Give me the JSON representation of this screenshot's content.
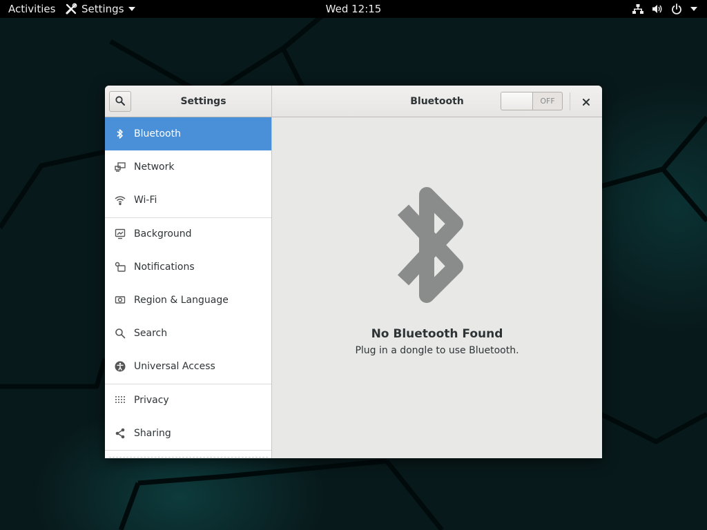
{
  "topbar": {
    "activities": "Activities",
    "app_name": "Settings",
    "clock": "Wed 12:15"
  },
  "window": {
    "left_title": "Settings",
    "panel_title": "Bluetooth",
    "toggle": {
      "state": "OFF",
      "on": false
    }
  },
  "sidebar": {
    "items": [
      {
        "label": "Bluetooth",
        "icon": "bluetooth-icon",
        "selected": true
      },
      {
        "label": "Network",
        "icon": "network-icon"
      },
      {
        "label": "Wi-Fi",
        "icon": "wifi-icon"
      },
      {
        "label": "Background",
        "icon": "background-icon"
      },
      {
        "label": "Notifications",
        "icon": "notifications-icon"
      },
      {
        "label": "Region & Language",
        "icon": "region-language-icon"
      },
      {
        "label": "Search",
        "icon": "search-icon"
      },
      {
        "label": "Universal Access",
        "icon": "universal-access-icon"
      },
      {
        "label": "Privacy",
        "icon": "privacy-icon"
      },
      {
        "label": "Sharing",
        "icon": "sharing-icon"
      }
    ]
  },
  "content": {
    "title": "No Bluetooth Found",
    "subtitle": "Plug in a dongle to use Bluetooth."
  },
  "colors": {
    "accent": "#4a90d9",
    "topbar": "#000000",
    "content_bg": "#e8e8e7",
    "bluetooth_glyph": "#8a8c8b"
  }
}
